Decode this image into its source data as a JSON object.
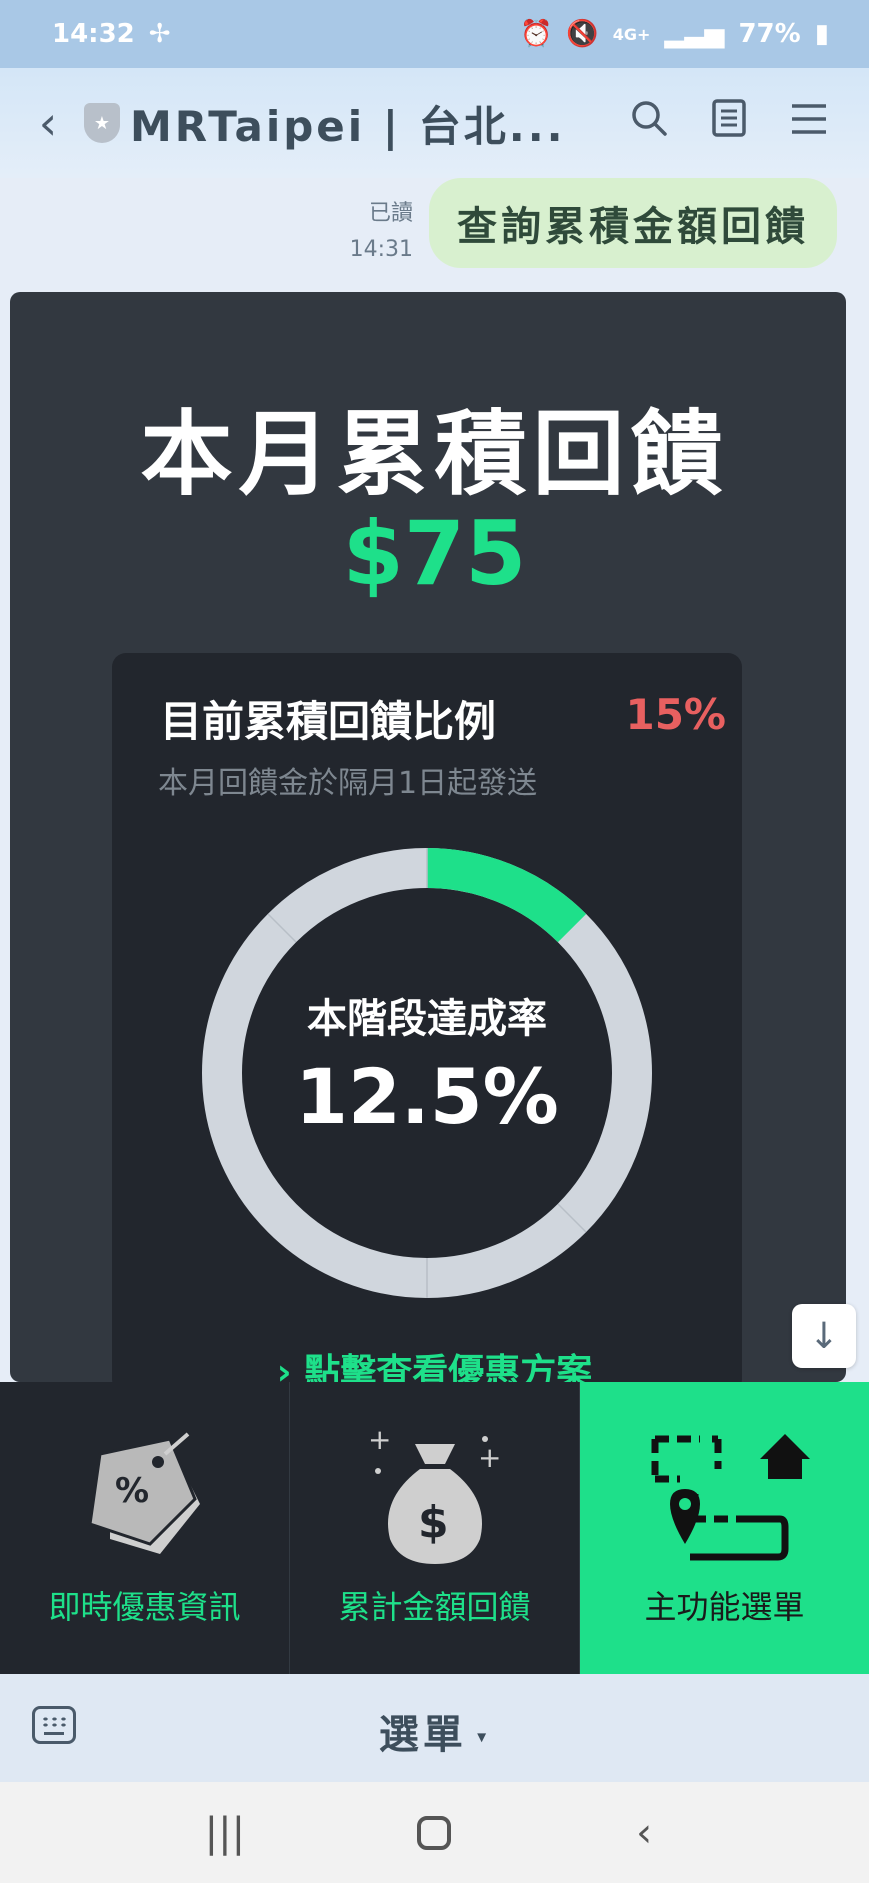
{
  "status_bar": {
    "time": "14:32",
    "battery": "77%",
    "network": "4G+"
  },
  "chat_header": {
    "title": "MRTaipei | 台北...",
    "back_icon": "chevron-left-icon",
    "search_icon": "search-icon",
    "notes_icon": "notes-icon",
    "menu_icon": "hamburger-menu-icon"
  },
  "sent_message": {
    "read_label": "已讀",
    "time": "14:31",
    "text": "查詢累積金額回饋"
  },
  "card": {
    "title": "本月累積回饋",
    "amount": "$75",
    "rate_label": "目前累積回饋比例",
    "rate_value": "15%",
    "rate_note": "本月回饋金於隔月1日起發送",
    "progress_label": "本階段達成率",
    "progress_value": "12.5%",
    "progress_fraction": 0.125,
    "link_text": "點擊查看優惠方案",
    "colors": {
      "accent": "#1ee08a",
      "rate": "#e86060",
      "track": "#d0d6dd"
    }
  },
  "rich_menu": {
    "items": [
      {
        "label": "即時優惠資訊",
        "icon": "discount-tag-icon"
      },
      {
        "label": "累計金額回饋",
        "icon": "money-bag-icon"
      },
      {
        "label": "主功能選單",
        "icon": "route-map-icon"
      }
    ]
  },
  "menu_bar": {
    "label": "選單",
    "keyboard_icon": "keyboard-icon"
  },
  "nav_bar": {
    "recents_icon": "recents-icon",
    "home_icon": "home-icon",
    "back_icon": "back-icon"
  }
}
